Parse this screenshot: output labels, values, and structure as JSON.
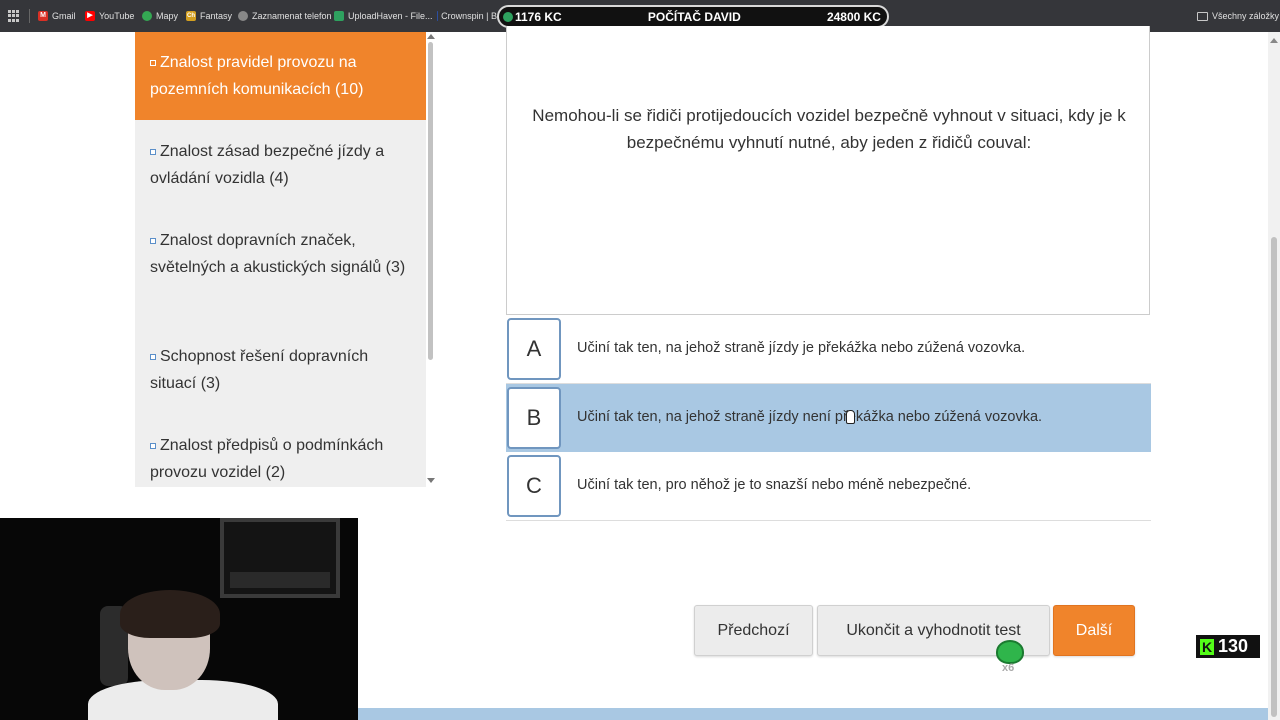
{
  "bookmarks": {
    "items": [
      {
        "label": "Gmail",
        "icon": "gmail-icon",
        "color": "#d93025",
        "glyph": "M"
      },
      {
        "label": "YouTube",
        "icon": "youtube-icon",
        "color": "#ff0000",
        "glyph": "▶"
      },
      {
        "label": "Mapy",
        "icon": "maps-icon",
        "color": "#34a853",
        "glyph": "●"
      },
      {
        "label": "Fantasy",
        "icon": "fantasy-icon",
        "color": "#d4a020",
        "glyph": "Ch"
      },
      {
        "label": "Zaznamenat telefon",
        "icon": "globe-icon",
        "color": "#888888",
        "glyph": "◎"
      },
      {
        "label": "UploadHaven - File...",
        "icon": "uploadhaven-icon",
        "color": "#2ea15f",
        "glyph": "▲"
      },
      {
        "label": "Crownspin | B",
        "icon": "crownspin-icon",
        "color": "#2b4ea0",
        "glyph": "♛"
      }
    ],
    "all_bookmarks": "Všechny záložky"
  },
  "overlay": {
    "left_amount": "1176 KC",
    "center_label": "POČÍTAČ DAVID",
    "right_amount": "24800 KC"
  },
  "sidebar": {
    "items": [
      {
        "label": "Znalost pravidel provozu na pozemních komunikacích (10)",
        "active": true
      },
      {
        "label": "Znalost zásad bezpečné jízdy a ovládání vozidla (4)",
        "active": false
      },
      {
        "label": "Znalost dopravních značek, světelných a akustických signálů (3)",
        "active": false
      },
      {
        "label": "Schopnost řešení dopravních situací (3)",
        "active": false
      },
      {
        "label": "Znalost předpisů o podmínkách provozu vozidel (2)",
        "active": false
      }
    ]
  },
  "question": {
    "text": "Nemohou-li se řidiči protijedoucích vozidel bezpečně vyhnout v situaci, kdy je k bezpečnému vyhnutí nutné, aby jeden z řidičů couval:"
  },
  "answers": [
    {
      "letter": "A",
      "text": "Učiní tak ten, na jehož straně jízdy je překážka nebo zúžená vozovka.",
      "selected": false
    },
    {
      "letter": "B",
      "text": "Učiní tak ten, na jehož straně jízdy není překážka nebo zúžená vozovka.",
      "selected": true
    },
    {
      "letter": "C",
      "text": "Učiní tak ten, pro něhož je to snazší nebo méně nebezpečné.",
      "selected": false
    }
  ],
  "buttons": {
    "previous": "Předchozí",
    "finish": "Ukončit a vyhodnotit test",
    "next": "Další"
  },
  "sticker": {
    "label": "x6"
  },
  "viewer_badge": {
    "logo": "K",
    "count": "130"
  },
  "colors": {
    "accent_orange": "#f0842b",
    "selected_blue": "#a9c8e3",
    "letter_border": "#7096bf"
  }
}
